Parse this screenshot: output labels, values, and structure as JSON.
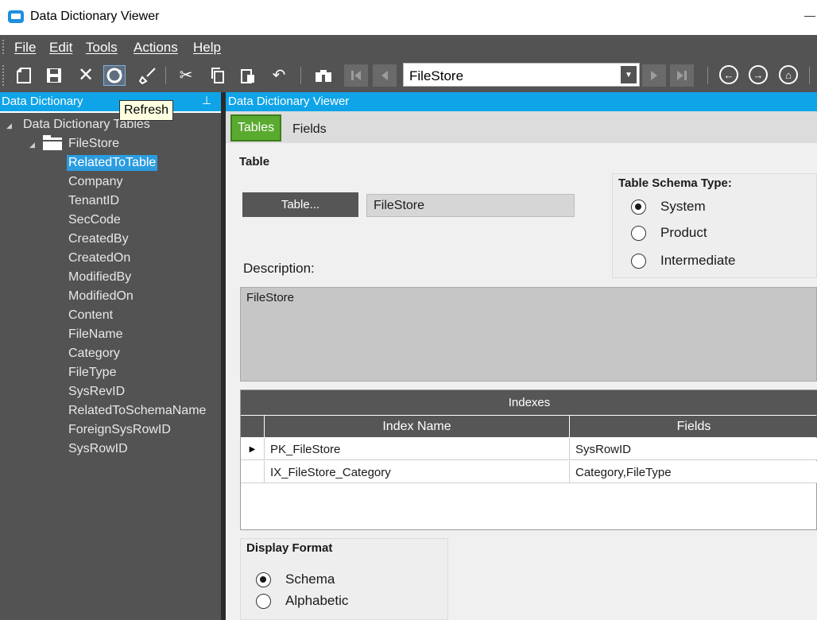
{
  "window": {
    "title": "Data Dictionary Viewer"
  },
  "menu": [
    {
      "label": "File"
    },
    {
      "label": "Edit"
    },
    {
      "label": "Tools"
    },
    {
      "label": "Actions"
    },
    {
      "label": "Help"
    }
  ],
  "toolbar": {
    "table_selector_value": "FileStore",
    "tooltip": "Refresh",
    "icons": [
      "new-icon",
      "save-icon",
      "delete-icon",
      "refresh-icon",
      "clear-icon",
      "cut-icon",
      "copy-icon",
      "paste-icon",
      "undo-icon",
      "search-icon",
      "first-icon",
      "previous-icon",
      "next-icon",
      "last-icon",
      "back-icon",
      "forward-icon",
      "home-icon"
    ]
  },
  "left_panel": {
    "title": "Data Dictionary",
    "root": "Data Dictionary Tables",
    "table": "FileStore",
    "selected_field": "RelatedToTable",
    "fields": [
      "Company",
      "TenantID",
      "SecCode",
      "CreatedBy",
      "CreatedOn",
      "ModifiedBy",
      "ModifiedOn",
      "Content",
      "FileName",
      "Category",
      "FileType",
      "SysRevID",
      "RelatedToSchemaName",
      "ForeignSysRowID",
      "SysRowID"
    ]
  },
  "right_panel": {
    "title": "Data Dictionary Viewer",
    "tabs": [
      {
        "label": "Tables"
      },
      {
        "label": "Fields"
      }
    ],
    "active_tab": "Tables",
    "table_section": {
      "title": "Table",
      "button_label": "Table...",
      "table_value": "FileStore",
      "description_label": "Description:",
      "description_value": "FileStore"
    },
    "schema_type": {
      "title": "Table Schema Type:",
      "options": [
        "System",
        "Product",
        "Intermediate"
      ],
      "selected": "System"
    },
    "indexes": {
      "title": "Indexes",
      "columns": [
        "Index Name",
        "Fields"
      ],
      "rows": [
        {
          "name": "PK_FileStore",
          "fields": "SysRowID"
        },
        {
          "name": "IX_FileStore_Category",
          "fields": "Category,FileType"
        }
      ]
    },
    "display_format": {
      "title": "Display Format",
      "options": [
        "Schema",
        "Alphabetic"
      ],
      "selected": "Schema"
    }
  },
  "colors": {
    "accent": "#0fa4e8",
    "active_tab": "#5aaa2f",
    "panel_bg": "#535353"
  }
}
